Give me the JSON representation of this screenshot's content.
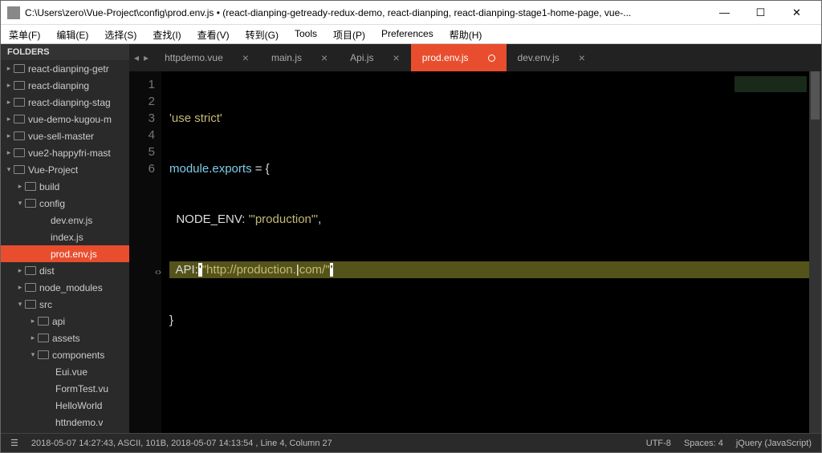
{
  "window": {
    "title": "C:\\Users\\zero\\Vue-Project\\config\\prod.env.js • (react-dianping-getready-redux-demo, react-dianping, react-dianping-stage1-home-page, vue-..."
  },
  "menu": [
    "菜单(F)",
    "编辑(E)",
    "选择(S)",
    "查找(I)",
    "查看(V)",
    "转到(G)",
    "Tools",
    "项目(P)",
    "Preferences",
    "帮助(H)"
  ],
  "sidebar": {
    "header": "FOLDERS",
    "items": [
      {
        "indent": 0,
        "arrow": "▸",
        "icon": true,
        "label": "react-dianping-getr"
      },
      {
        "indent": 0,
        "arrow": "▸",
        "icon": true,
        "label": "react-dianping"
      },
      {
        "indent": 0,
        "arrow": "▸",
        "icon": true,
        "label": "react-dianping-stag"
      },
      {
        "indent": 0,
        "arrow": "▸",
        "icon": true,
        "label": "vue-demo-kugou-m"
      },
      {
        "indent": 0,
        "arrow": "▸",
        "icon": true,
        "label": "vue-sell-master"
      },
      {
        "indent": 0,
        "arrow": "▸",
        "icon": true,
        "label": "vue2-happyfri-mast"
      },
      {
        "indent": 0,
        "arrow": "▾",
        "icon": true,
        "label": "Vue-Project"
      },
      {
        "indent": 1,
        "arrow": "▸",
        "icon": true,
        "label": "build"
      },
      {
        "indent": 1,
        "arrow": "▾",
        "icon": true,
        "label": "config"
      },
      {
        "indent": 3,
        "arrow": "",
        "icon": false,
        "label": "dev.env.js"
      },
      {
        "indent": 3,
        "arrow": "",
        "icon": false,
        "label": "index.js"
      },
      {
        "indent": 3,
        "arrow": "",
        "icon": false,
        "label": "prod.env.js",
        "selected": true
      },
      {
        "indent": 1,
        "arrow": "▸",
        "icon": true,
        "label": "dist"
      },
      {
        "indent": 1,
        "arrow": "▸",
        "icon": true,
        "label": "node_modules"
      },
      {
        "indent": 1,
        "arrow": "▾",
        "icon": true,
        "label": "src"
      },
      {
        "indent": 2,
        "arrow": "▸",
        "icon": true,
        "label": "api"
      },
      {
        "indent": 2,
        "arrow": "▸",
        "icon": true,
        "label": "assets"
      },
      {
        "indent": 2,
        "arrow": "▾",
        "icon": true,
        "label": "components"
      },
      {
        "indent": 4,
        "arrow": "",
        "icon": false,
        "label": "Eui.vue"
      },
      {
        "indent": 4,
        "arrow": "",
        "icon": false,
        "label": "FormTest.vu"
      },
      {
        "indent": 4,
        "arrow": "",
        "icon": false,
        "label": "HelloWorld"
      },
      {
        "indent": 4,
        "arrow": "",
        "icon": false,
        "label": "httndemo.v"
      }
    ]
  },
  "tabs": [
    {
      "label": "httpdemo.vue",
      "active": false,
      "mark": "×"
    },
    {
      "label": "main.js",
      "active": false,
      "mark": "×"
    },
    {
      "label": "Api.js",
      "active": false,
      "mark": "×"
    },
    {
      "label": "prod.env.js",
      "active": true,
      "mark": "○"
    },
    {
      "label": "dev.env.js",
      "active": false,
      "mark": "×"
    }
  ],
  "editor": {
    "lines": [
      "1",
      "2",
      "3",
      "4",
      "5",
      "6"
    ],
    "code": {
      "l1_str": "'use strict'",
      "l2a": "module",
      "l2b": ".",
      "l2c": "exports",
      "l2d": " = {",
      "l3a": "  NODE_ENV: ",
      "l3b": "'\"production\"'",
      "l3c": ",",
      "l4a": "  API:",
      "l4q1": "'",
      "l4b": "\"http://production.",
      "l4cur": "|",
      "l4c": "com/\"",
      "l4q2": "'",
      "l5": "}"
    }
  },
  "status": {
    "left": "2018-05-07 14:27:43, ASCII, 101B, 2018-05-07 14:13:54 , Line 4, Column 27",
    "encoding": "UTF-8",
    "spaces": "Spaces: 4",
    "syntax": "jQuery (JavaScript)"
  }
}
